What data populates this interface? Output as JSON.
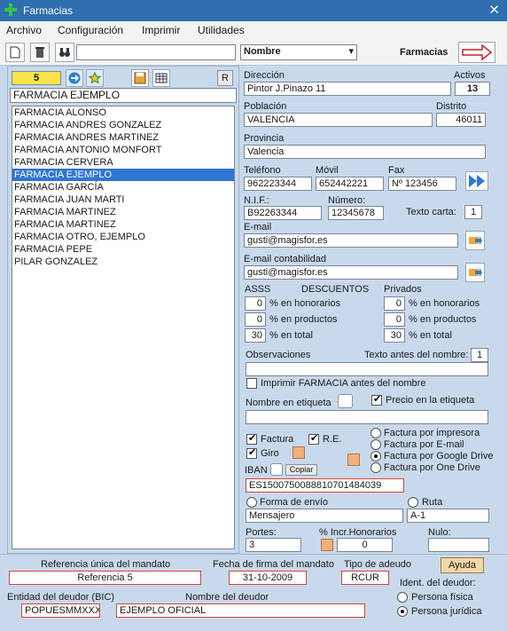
{
  "window": {
    "title": "Farmacias"
  },
  "menu": [
    "Archivo",
    "Configuración",
    "Imprimir",
    "Utilidades"
  ],
  "toolbar": {
    "search_value": "",
    "sort_select": "Nombre",
    "section_label": "Farmacias"
  },
  "left": {
    "counter": "5",
    "r_label": "R",
    "current_name": "FARMACIA EJEMPLO",
    "list": [
      "FARMACIA ALONSO",
      "FARMACIA ANDRES GONZALEZ",
      "FARMACIA ANDRES MARTINEZ",
      "FARMACIA ANTONIO MONFORT",
      "FARMACIA CERVERA",
      "FARMACIA EJEMPLO",
      "FARMACIA GARCÍA",
      "FARMACIA JUAN MARTI",
      "FARMACIA MARTINEZ",
      "FARMACIA MARTINEZ",
      "FARMACIA OTRO, EJEMPLO",
      "FARMACIA PEPE",
      "PILAR GONZALEZ"
    ],
    "selected_index": 5
  },
  "form": {
    "direccion_label": "Dirección",
    "direccion": "Pintor J.Pinazo 11",
    "activos_label": "Activos",
    "activos": "13",
    "poblacion_label": "Población",
    "poblacion": "VALENCIA",
    "distrito_label": "Distrito",
    "distrito": "46011",
    "provincia_label": "Provincia",
    "provincia": "Valencia",
    "telefono_label": "Teléfono",
    "telefono": "962223344",
    "movil_label": "Móvil",
    "movil": "652442221",
    "fax_label": "Fax",
    "fax": "Nº 123456",
    "nif_label": "N.I.F.:",
    "nif": "B92263344",
    "numero_label": "Número:",
    "numero": "12345678",
    "texto_carta_label": "Texto carta:",
    "texto_carta": "1",
    "email_label": "E-mail",
    "email": "gusti@magisfor.es",
    "email_cont_label": "E-mail contabilidad",
    "email_cont": "gusti@magisfor.es",
    "asss_label": "ASSS",
    "descuentos_label": "DESCUENTOS",
    "privados_label": "Privados",
    "asss_honorarios": "0",
    "asss_productos": "0",
    "asss_total": "30",
    "priv_honorarios": "0",
    "priv_productos": "0",
    "priv_total": "30",
    "en_honorarios": "% en honorarios",
    "en_productos": "% en productos",
    "en_total": "% en total",
    "observaciones_label": "Observaciones",
    "observaciones": "",
    "texto_antes_label": "Texto antes del nombre:",
    "texto_antes": "1",
    "imprimir_antes_label": "Imprimir FARMACIA antes del nombre",
    "nombre_etiqueta_label": "Nombre en etiqueta",
    "nombre_etiqueta": "",
    "precio_etiqueta_label": "Precio en la etiqueta",
    "factura_label": "Factura",
    "re_label": "R.E.",
    "giro_label": "Giro",
    "fact_impresora": "Factura por impresora",
    "fact_email": "Factura por E-mail",
    "fact_gdrive": "Factura por Google Drive",
    "fact_onedrive": "Factura por One Drive",
    "iban_label": "IBAN",
    "copiar_label": "Copiar",
    "iban": "ES1500750088810701484039",
    "forma_envio_label": "Forma de envío",
    "forma_envio": "Mensajero",
    "ruta_label": "Ruta",
    "ruta": "A-1",
    "portes_label": "Portes:",
    "portes": "3",
    "incr_label": "% Incr.Honorarios",
    "incr": "0",
    "nulo_label": "Nulo:",
    "nulo": ""
  },
  "bottom": {
    "ref_label": "Referencia única del mandato",
    "ref": "Referencia 5",
    "fecha_label": "Fecha de firma del mandato",
    "fecha": "31-10-2009",
    "tipo_label": "Tipo de adeudo",
    "tipo": "RCUR",
    "ayuda": "Ayuda",
    "bic_label": "Entidad del deudor (BIC)",
    "bic": "POPUESMMXXX",
    "nombre_deudor_label": "Nombre del deudor",
    "nombre_deudor": "EJEMPLO OFICIAL",
    "ident_label": "Ident. del deudor:",
    "fisica": "Persona física",
    "juridica": "Persona jurídica"
  }
}
